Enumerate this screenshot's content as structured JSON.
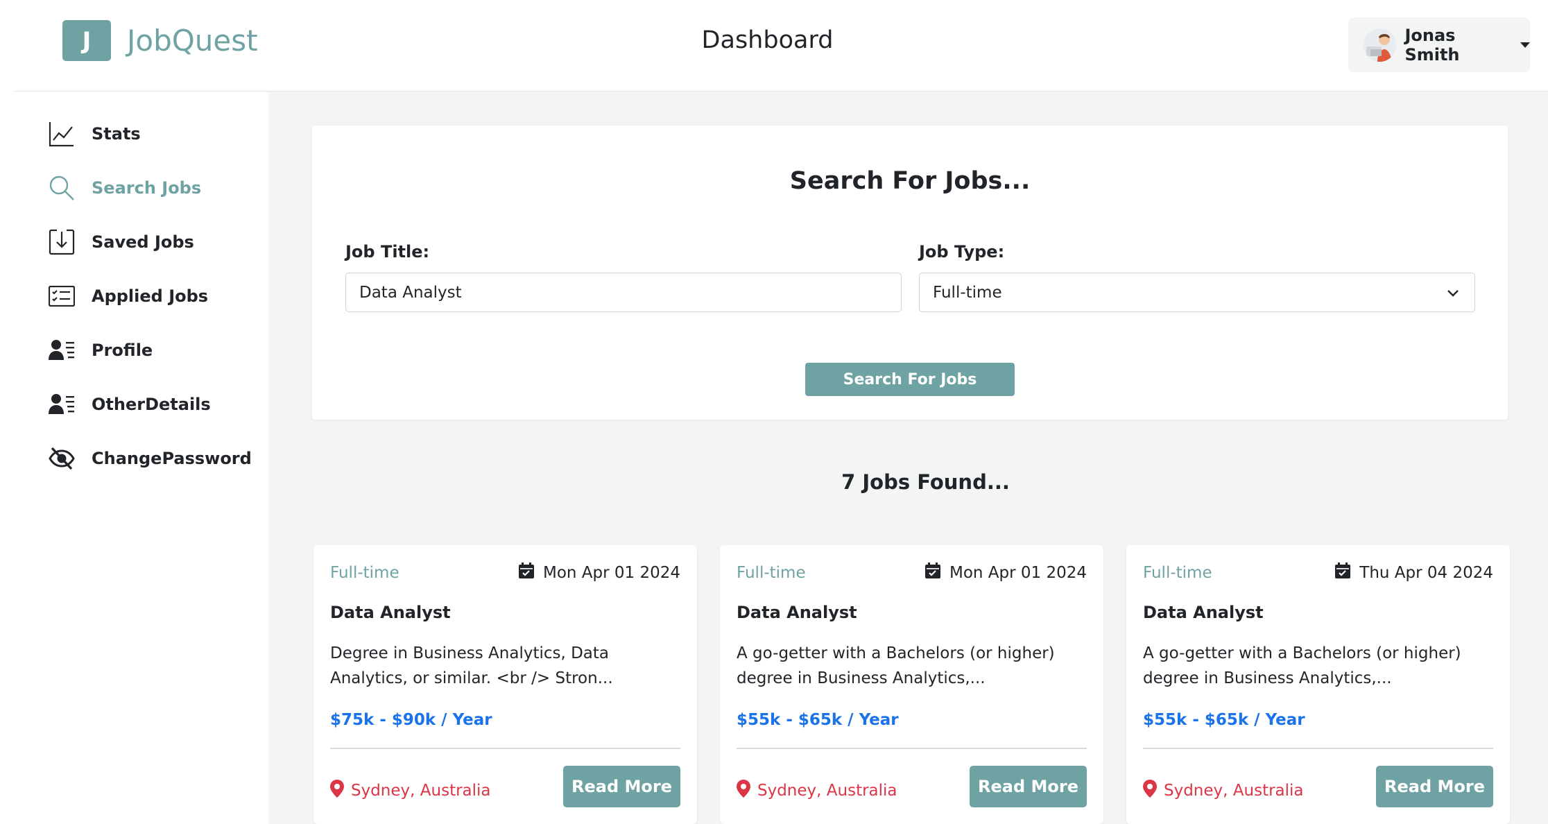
{
  "app": {
    "logo_letter": "J",
    "name": "JobQuest",
    "page_title": "Dashboard"
  },
  "user": {
    "name": "Jonas Smith"
  },
  "sidebar": {
    "items": [
      {
        "label": "Stats",
        "icon": "chart-line-icon"
      },
      {
        "label": "Search Jobs",
        "icon": "search-icon",
        "active": true
      },
      {
        "label": "Saved Jobs",
        "icon": "save-download-icon"
      },
      {
        "label": "Applied Jobs",
        "icon": "list-check-icon"
      },
      {
        "label": "Profile",
        "icon": "user-list-icon"
      },
      {
        "label": "OtherDetails",
        "icon": "user-list-icon"
      },
      {
        "label": "ChangePassword",
        "icon": "eye-slash-icon"
      }
    ]
  },
  "search": {
    "title": "Search For Jobs...",
    "job_title_label": "Job Title:",
    "job_title_value": "Data Analyst",
    "job_type_label": "Job Type:",
    "job_type_value": "Full-time",
    "button_label": "Search For Jobs"
  },
  "results": {
    "heading": "7 Jobs Found..."
  },
  "jobs": [
    {
      "type": "Full-time",
      "date": "Mon Apr 01 2024",
      "title": "Data Analyst",
      "description": "Degree in Business Analytics, Data Analytics, or similar. <br /> Stron...",
      "salary": "$75k - $90k / Year",
      "location": "Sydney, Australia",
      "button": "Read More"
    },
    {
      "type": "Full-time",
      "date": "Mon Apr 01 2024",
      "title": "Data Analyst",
      "description": "A go-getter with a Bachelors (or higher) degree in Business Analytics,...",
      "salary": "$55k - $65k / Year",
      "location": "Sydney, Australia",
      "button": "Read More"
    },
    {
      "type": "Full-time",
      "date": "Thu Apr 04 2024",
      "title": "Data Analyst",
      "description": "A go-getter with a Bachelors (or higher) degree in Business Analytics,...",
      "salary": "$55k - $65k / Year",
      "location": "Sydney, Australia",
      "button": "Read More"
    }
  ],
  "colors": {
    "accent": "#6fa3a3",
    "salary": "#1a73e8",
    "location": "#dc3545",
    "background": "#f3f4f4"
  }
}
